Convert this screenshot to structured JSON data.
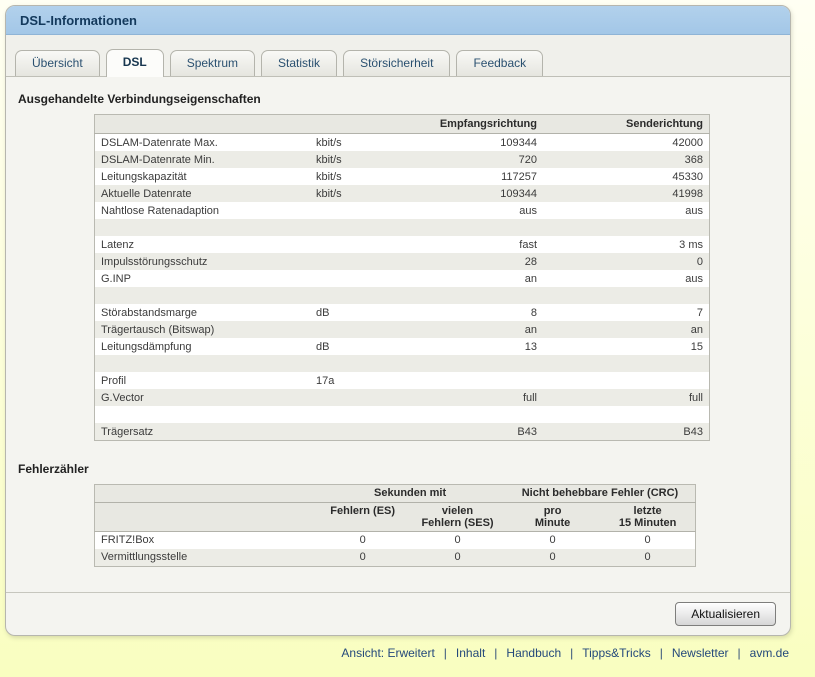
{
  "window": {
    "title": "DSL-Informationen"
  },
  "tabs": [
    {
      "label": "Übersicht",
      "active": false
    },
    {
      "label": "DSL",
      "active": true
    },
    {
      "label": "Spektrum",
      "active": false
    },
    {
      "label": "Statistik",
      "active": false
    },
    {
      "label": "Störsicherheit",
      "active": false
    },
    {
      "label": "Feedback",
      "active": false
    }
  ],
  "sections": [
    {
      "title": "Ausgehandelte Verbindungseigenschaften",
      "table": {
        "headers": [
          "",
          "",
          "Empfangsrichtung",
          "Senderichtung"
        ],
        "rows": [
          [
            "DSLAM-Datenrate Max.",
            "kbit/s",
            "109344",
            "42000"
          ],
          [
            "DSLAM-Datenrate Min.",
            "kbit/s",
            "720",
            "368"
          ],
          [
            "Leitungskapazität",
            "kbit/s",
            "117257",
            "45330"
          ],
          [
            "Aktuelle Datenrate",
            "kbit/s",
            "109344",
            "41998"
          ],
          [
            "Nahtlose Ratenadaption",
            "",
            "aus",
            "aus"
          ],
          [
            "",
            "",
            "",
            ""
          ],
          [
            "Latenz",
            "",
            "fast",
            "3 ms"
          ],
          [
            "Impulsstörungsschutz",
            "",
            "28",
            "0"
          ],
          [
            "G.INP",
            "",
            "an",
            "aus"
          ],
          [
            "",
            "",
            "",
            ""
          ],
          [
            "Störabstandsmarge",
            "dB",
            "8",
            "7"
          ],
          [
            "Trägertausch (Bitswap)",
            "",
            "an",
            "an"
          ],
          [
            "Leitungsdämpfung",
            "dB",
            "13",
            "15"
          ],
          [
            "",
            "",
            "",
            ""
          ],
          [
            "Profil",
            "17a",
            "",
            ""
          ],
          [
            "G.Vector",
            "",
            "full",
            "full"
          ],
          [
            "",
            "",
            "",
            ""
          ],
          [
            "Trägersatz",
            "",
            "B43",
            "B43"
          ]
        ]
      }
    },
    {
      "title": "Fehlerzähler",
      "table": {
        "group_headers": [
          "Sekunden mit",
          "Nicht behebbare Fehler (CRC)"
        ],
        "col_headers": [
          "Fehlern (ES)",
          "vielen\nFehlern (SES)",
          "pro\nMinute",
          "letzte\n15 Minuten"
        ],
        "rows": [
          [
            "FRITZ!Box",
            "0",
            "0",
            "0",
            "0"
          ],
          [
            "Vermittlungsstelle",
            "0",
            "0",
            "0",
            "0"
          ]
        ]
      }
    }
  ],
  "actions": {
    "refresh_label": "Aktualisieren"
  },
  "footer": {
    "items": [
      "Ansicht: Erweitert",
      "Inhalt",
      "Handbuch",
      "Tipps&Tricks",
      "Newsletter",
      "avm.de"
    ],
    "separator": "|"
  },
  "colors": {
    "titlebar_blue": "#A9CBE9",
    "title_text": "#13395C",
    "page_gradient_top": "#FFFFF3",
    "page_gradient_bottom": "#F9FEC0",
    "panel_bg": "#F4F4F0",
    "table_stripe": "#ECECE6",
    "table_header_bg": "#E8E8E2",
    "link_blue": "#24497B"
  }
}
